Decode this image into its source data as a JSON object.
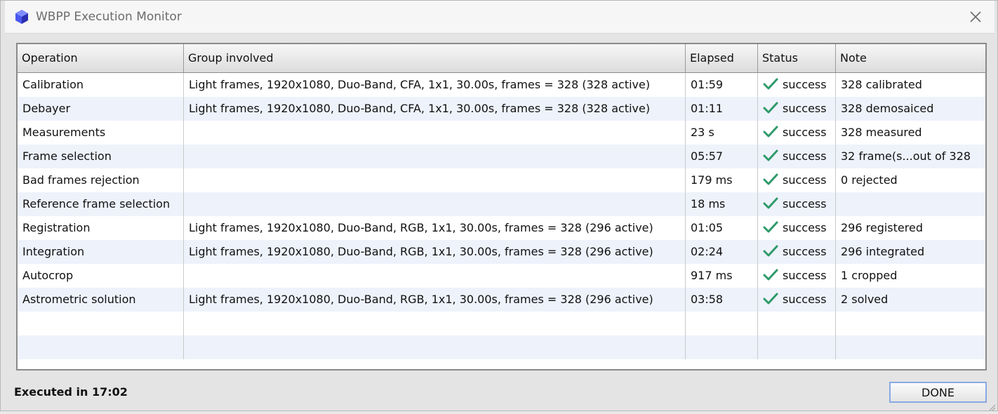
{
  "window": {
    "title": "WBPP Execution Monitor",
    "icon": "pixinsight-cube-icon",
    "close_icon": "close-icon"
  },
  "table": {
    "columns": [
      "Operation",
      "Group involved",
      "Elapsed",
      "Status",
      "Note"
    ],
    "rows": [
      {
        "operation": "Calibration",
        "group": "Light frames, 1920x1080, Duo-Band, CFA, 1x1, 30.00s, frames = 328 (328 active)",
        "elapsed": "01:59",
        "status": "success",
        "note": "328 calibrated"
      },
      {
        "operation": "Debayer",
        "group": "Light frames, 1920x1080, Duo-Band, CFA, 1x1, 30.00s, frames = 328 (328 active)",
        "elapsed": "01:11",
        "status": "success",
        "note": "328 demosaiced"
      },
      {
        "operation": "Measurements",
        "group": "",
        "elapsed": "23 s",
        "status": "success",
        "note": "328 measured"
      },
      {
        "operation": "Frame selection",
        "group": "",
        "elapsed": "05:57",
        "status": "success",
        "note": "32 frame(s...out of 328"
      },
      {
        "operation": "Bad frames rejection",
        "group": "",
        "elapsed": "179 ms",
        "status": "success",
        "note": "0 rejected"
      },
      {
        "operation": "Reference frame selection",
        "group": "",
        "elapsed": "18 ms",
        "status": "success",
        "note": ""
      },
      {
        "operation": "Registration",
        "group": "Light frames, 1920x1080, Duo-Band, RGB, 1x1, 30.00s, frames = 328 (296 active)",
        "elapsed": "01:05",
        "status": "success",
        "note": "296 registered"
      },
      {
        "operation": "Integration",
        "group": "Light frames, 1920x1080, Duo-Band, RGB, 1x1, 30.00s, frames = 328 (296 active)",
        "elapsed": "02:24",
        "status": "success",
        "note": "296 integrated"
      },
      {
        "operation": "Autocrop",
        "group": "",
        "elapsed": "917 ms",
        "status": "success",
        "note": "1 cropped"
      },
      {
        "operation": "Astrometric solution",
        "group": "Light frames, 1920x1080, Duo-Band, RGB, 1x1, 30.00s, frames = 328 (296 active)",
        "elapsed": "03:58",
        "status": "success",
        "note": "2 solved"
      }
    ],
    "status_icon": "checkmark-icon",
    "status_color": "#2e9a6a",
    "alt_row_color": "#eef2fb"
  },
  "footer": {
    "executed_text": "Executed in 17:02",
    "done_label": "DONE"
  }
}
